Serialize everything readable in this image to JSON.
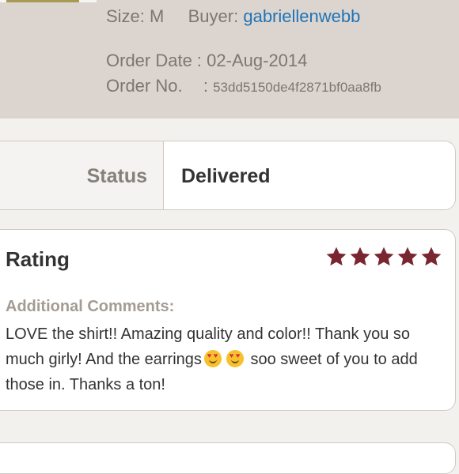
{
  "order": {
    "size_label": "Size:",
    "size_value": "M",
    "buyer_label": "Buyer:",
    "buyer_value": "gabriellenwebb",
    "date_label": "Order Date :",
    "date_value": "02-Aug-2014",
    "number_label": "Order No.",
    "number_sep": ":",
    "number_value": "53dd5150de4f2871bf0aa8fb"
  },
  "status": {
    "label": "Status",
    "value": "Delivered"
  },
  "rating": {
    "title": "Rating",
    "stars": 5,
    "star_color": "#7a2630",
    "comments_label": "Additional Comments:",
    "comment_part1": "LOVE the shirt!! Amazing quality and color!! Thank you so much girly! And the earrings",
    "comment_part2": "soo sweet of you to add those in. Thanks a ton!",
    "emoji_icon": "heart-eyes-emoji"
  },
  "colors": {
    "header_bg": "#dcd5cf",
    "link": "#1f74b8",
    "page_bg": "#f3f1ee"
  }
}
